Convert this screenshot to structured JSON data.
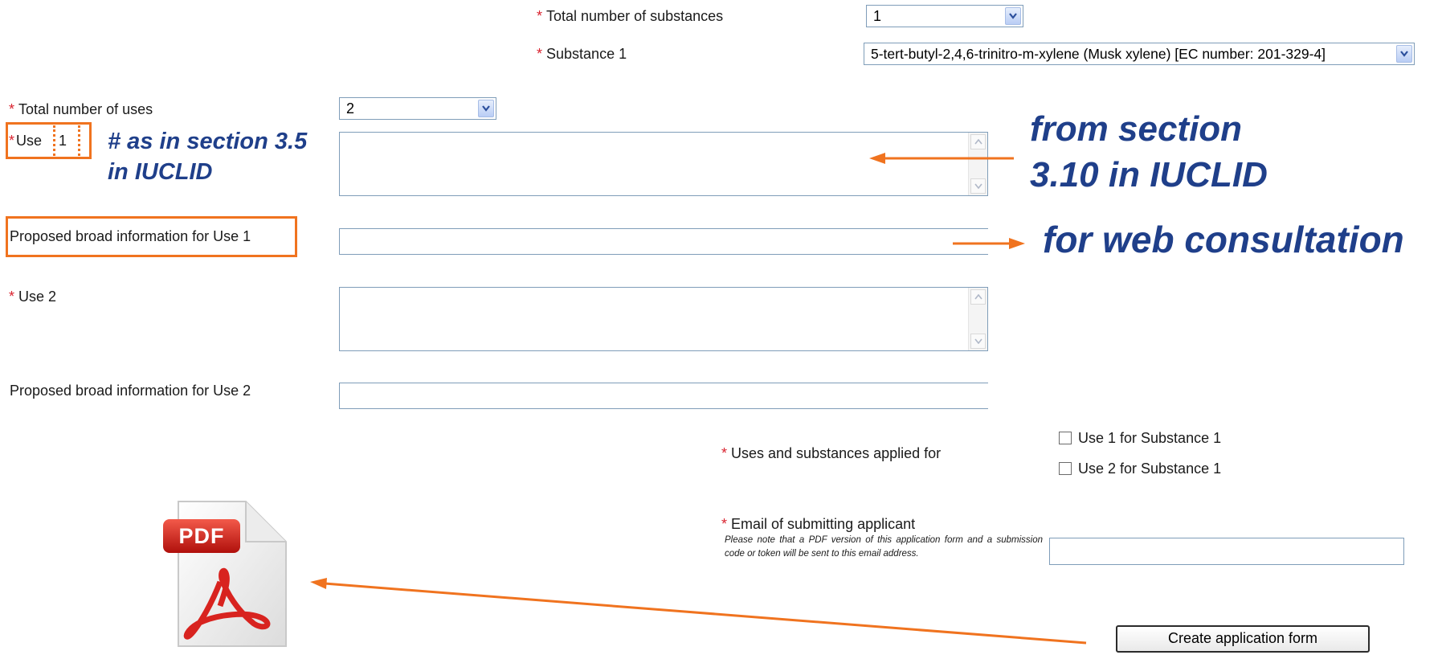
{
  "substances": {
    "total_label": "Total number of substances",
    "total_value": "1",
    "substance1_label": "Substance 1",
    "substance1_value": "5-tert-butyl-2,4,6-trinitro-m-xylene (Musk xylene) [EC number: 201-329-4]"
  },
  "uses": {
    "total_label": "Total number of uses",
    "total_value": "2",
    "use1_label_prefix": "Use",
    "use1_number": "1",
    "proposed1_label": "Proposed broad information for Use 1",
    "use2_label": "Use 2",
    "proposed2_label": "Proposed broad information for Use 2"
  },
  "required_marker": "*",
  "applied": {
    "label": "Uses and substances applied for",
    "options": [
      "Use 1 for Substance 1",
      "Use 2 for Substance 1"
    ]
  },
  "email": {
    "label": "Email of submitting applicant",
    "note": "Please note that a PDF version of this application form and a submission code or token will be sent to this email address.",
    "value": ""
  },
  "create_button": "Create application form",
  "pdf_icon_text": "PDF",
  "annotations": {
    "hash_line1": "# as in section 3.5",
    "hash_line2": "in IUCLID",
    "from_line1": "from section",
    "from_line2": "3.10 in IUCLID",
    "web": "for web consultation"
  },
  "colors": {
    "annotation_text": "#1f3f8a",
    "highlight_orange": "#f0731f",
    "required_red": "#d9232f",
    "field_border": "#7f9db9"
  }
}
